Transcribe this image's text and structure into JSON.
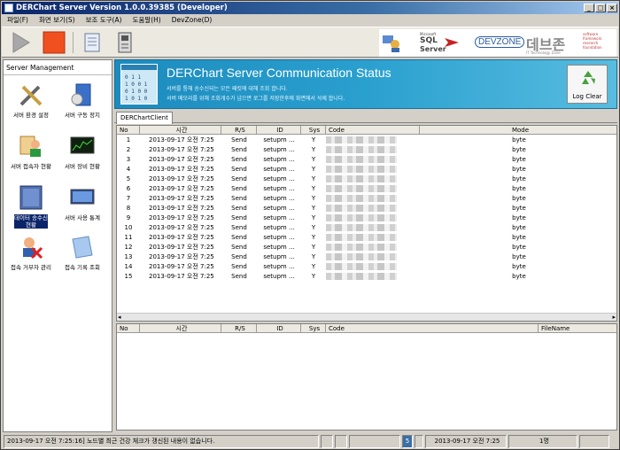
{
  "window": {
    "title": "DERChart Server Version 1.0.0.39385 (Developer)"
  },
  "menu": [
    "파일(F)",
    "화면 보기(S)",
    "보조 도구(A)",
    "도움말(H)",
    "DevZone(D)"
  ],
  "toolbar": {
    "play": "play-icon",
    "stop": "stop-icon",
    "doc": "document-icon",
    "device": "device-icon"
  },
  "logos": {
    "sql_small": "Microsoft",
    "sql": "SQL",
    "server": "Server",
    "devzone": "DEVZONE",
    "korean": "데브존",
    "tag1": "software",
    "tag2": "framework",
    "tag3": "research",
    "tag4": "foundation",
    "tagline": "IT Technology Zone"
  },
  "sidebar": {
    "header": "Server Management",
    "items": [
      {
        "label": "서버 환경 설정",
        "icon": "tools-icon"
      },
      {
        "label": "서버 구동 정지",
        "icon": "server-icon"
      },
      {
        "label": "서버 접속자 현황",
        "icon": "users-icon"
      },
      {
        "label": "서버 장비 현황",
        "icon": "monitor-icon"
      },
      {
        "label": "데이터 송수신 현황",
        "icon": "data-icon",
        "selected": true
      },
      {
        "label": "서버 사용 통계",
        "icon": "chart-icon"
      },
      {
        "label": "접속 거부자 관리",
        "icon": "block-user-icon"
      },
      {
        "label": "접속 기록 조회",
        "icon": "folder-icon"
      }
    ]
  },
  "banner": {
    "title": "DERChart Server Communication Status",
    "line1": "서버를 통해 송수신되는 모든 패킷에 대해 조회 합니다.",
    "line2": "서버 메모리를 위해 조회개수가 넘으면 로그를 저장한후에 화면에서 삭제 합니다.",
    "log_clear": "Log Clear"
  },
  "tab": "DERChartClient",
  "grid1": {
    "columns": [
      "No",
      "시간",
      "R/S",
      "ID",
      "Sys",
      "Code",
      "Mode"
    ],
    "rows": [
      {
        "no": "1",
        "time": "2013-09-17 오전 7:25",
        "rs": "Send",
        "id": "setupm ...",
        "sys": "Y",
        "mode": "byte"
      },
      {
        "no": "2",
        "time": "2013-09-17 오전 7:25",
        "rs": "Send",
        "id": "setupm ...",
        "sys": "Y",
        "mode": "byte"
      },
      {
        "no": "3",
        "time": "2013-09-17 오전 7:25",
        "rs": "Send",
        "id": "setupm ...",
        "sys": "Y",
        "mode": "byte"
      },
      {
        "no": "4",
        "time": "2013-09-17 오전 7:25",
        "rs": "Send",
        "id": "setupm ...",
        "sys": "Y",
        "mode": "byte"
      },
      {
        "no": "5",
        "time": "2013-09-17 오전 7:25",
        "rs": "Send",
        "id": "setupm ...",
        "sys": "Y",
        "mode": "byte"
      },
      {
        "no": "6",
        "time": "2013-09-17 오전 7:25",
        "rs": "Send",
        "id": "setupm ...",
        "sys": "Y",
        "mode": "byte"
      },
      {
        "no": "7",
        "time": "2013-09-17 오전 7:25",
        "rs": "Send",
        "id": "setupm ...",
        "sys": "Y",
        "mode": "byte"
      },
      {
        "no": "8",
        "time": "2013-09-17 오전 7:25",
        "rs": "Send",
        "id": "setupm ...",
        "sys": "Y",
        "mode": "byte"
      },
      {
        "no": "9",
        "time": "2013-09-17 오전 7:25",
        "rs": "Send",
        "id": "setupm ...",
        "sys": "Y",
        "mode": "byte"
      },
      {
        "no": "10",
        "time": "2013-09-17 오전 7:25",
        "rs": "Send",
        "id": "setupm ...",
        "sys": "Y",
        "mode": "byte"
      },
      {
        "no": "11",
        "time": "2013-09-17 오전 7:25",
        "rs": "Send",
        "id": "setupm ...",
        "sys": "Y",
        "mode": "byte"
      },
      {
        "no": "12",
        "time": "2013-09-17 오전 7:25",
        "rs": "Send",
        "id": "setupm ...",
        "sys": "Y",
        "mode": "byte"
      },
      {
        "no": "13",
        "time": "2013-09-17 오전 7:25",
        "rs": "Send",
        "id": "setupm ...",
        "sys": "Y",
        "mode": "byte"
      },
      {
        "no": "14",
        "time": "2013-09-17 오전 7:25",
        "rs": "Send",
        "id": "setupm ...",
        "sys": "Y",
        "mode": "byte"
      },
      {
        "no": "15",
        "time": "2013-09-17 오전 7:25",
        "rs": "Send",
        "id": "setupm ...",
        "sys": "Y",
        "mode": "byte"
      }
    ]
  },
  "grid2": {
    "columns": [
      "No",
      "시간",
      "R/S",
      "ID",
      "Sys",
      "Code",
      "FileName"
    ]
  },
  "status": {
    "message": "2013-09-17 오전 7:25:16] 노드별 최근 건강 체크가 갱신된 내용이 없습니다.",
    "count": "5",
    "datetime": "2013-09-17 오전 7:25",
    "users": "1명"
  }
}
